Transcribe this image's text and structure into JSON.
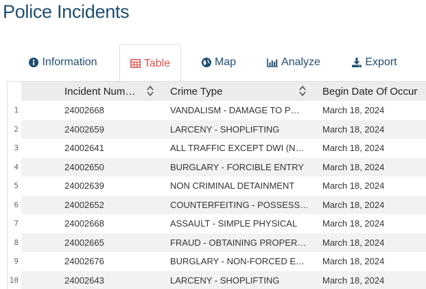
{
  "page": {
    "title": "Police Incidents"
  },
  "tabs": [
    {
      "label": "Information",
      "icon": "info-circle-icon",
      "active": false
    },
    {
      "label": "Table",
      "icon": "table-icon",
      "active": true
    },
    {
      "label": "Map",
      "icon": "globe-icon",
      "active": false
    },
    {
      "label": "Analyze",
      "icon": "bar-chart-icon",
      "active": false
    },
    {
      "label": "Export",
      "icon": "download-icon",
      "active": false
    }
  ],
  "colors": {
    "title": "#1f4e72",
    "active_tab": "#d9534f",
    "header_bg": "#ececec",
    "alt_row": "#f2f2f2"
  },
  "table": {
    "columns": [
      "Incident Num…",
      "Crime Type",
      "Begin Date Of Occur"
    ],
    "rows": [
      {
        "n": "1",
        "num": "24002668",
        "type": "VANDALISM - DAMAGE TO P…",
        "date": "March 18, 2024"
      },
      {
        "n": "2",
        "num": "24002659",
        "type": "LARCENY - SHOPLIFTING",
        "date": "March 18, 2024"
      },
      {
        "n": "3",
        "num": "24002641",
        "type": "ALL TRAFFIC EXCEPT DWI (N…",
        "date": "March 18, 2024"
      },
      {
        "n": "4",
        "num": "24002650",
        "type": "BURGLARY - FORCIBLE ENTRY",
        "date": "March 18, 2024"
      },
      {
        "n": "5",
        "num": "24002639",
        "type": "NON CRIMINAL DETAINMENT",
        "date": "March 18, 2024"
      },
      {
        "n": "6",
        "num": "24002652",
        "type": "COUNTERFEITING - POSSESS…",
        "date": "March 18, 2024"
      },
      {
        "n": "7",
        "num": "24002668",
        "type": "ASSAULT - SIMPLE PHYSICAL",
        "date": "March 18, 2024"
      },
      {
        "n": "8",
        "num": "24002665",
        "type": "FRAUD - OBTAINING PROPER…",
        "date": "March 18, 2024"
      },
      {
        "n": "9",
        "num": "24002676",
        "type": "BURGLARY - NON-FORCED E…",
        "date": "March 18, 2024"
      },
      {
        "n": "10",
        "num": "24002643",
        "type": "LARCENY - SHOPLIFTING",
        "date": "March 18, 2024"
      }
    ]
  }
}
